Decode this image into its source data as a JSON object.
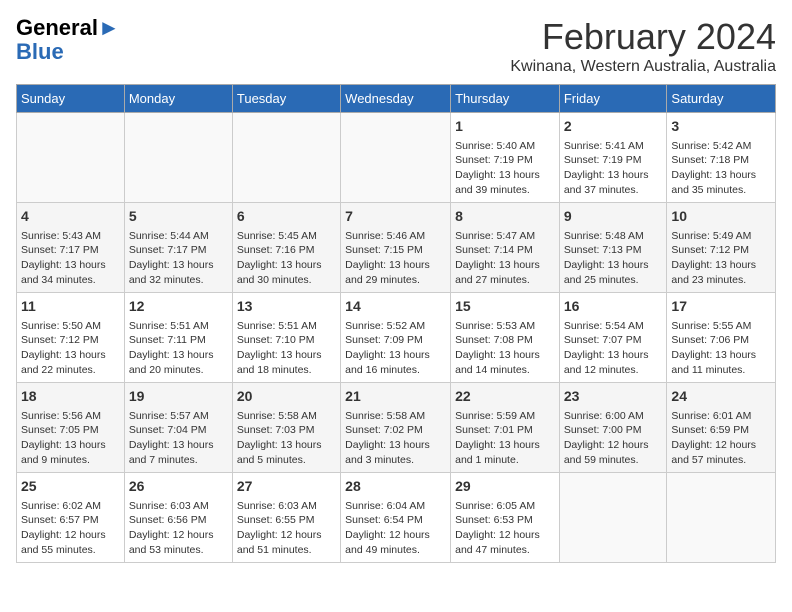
{
  "header": {
    "logo_general": "General",
    "logo_blue": "Blue",
    "title": "February 2024",
    "subtitle": "Kwinana, Western Australia, Australia"
  },
  "days_of_week": [
    "Sunday",
    "Monday",
    "Tuesday",
    "Wednesday",
    "Thursday",
    "Friday",
    "Saturday"
  ],
  "weeks": [
    [
      {
        "day": "",
        "content": ""
      },
      {
        "day": "",
        "content": ""
      },
      {
        "day": "",
        "content": ""
      },
      {
        "day": "",
        "content": ""
      },
      {
        "day": "1",
        "content": "Sunrise: 5:40 AM\nSunset: 7:19 PM\nDaylight: 13 hours\nand 39 minutes."
      },
      {
        "day": "2",
        "content": "Sunrise: 5:41 AM\nSunset: 7:19 PM\nDaylight: 13 hours\nand 37 minutes."
      },
      {
        "day": "3",
        "content": "Sunrise: 5:42 AM\nSunset: 7:18 PM\nDaylight: 13 hours\nand 35 minutes."
      }
    ],
    [
      {
        "day": "4",
        "content": "Sunrise: 5:43 AM\nSunset: 7:17 PM\nDaylight: 13 hours\nand 34 minutes."
      },
      {
        "day": "5",
        "content": "Sunrise: 5:44 AM\nSunset: 7:17 PM\nDaylight: 13 hours\nand 32 minutes."
      },
      {
        "day": "6",
        "content": "Sunrise: 5:45 AM\nSunset: 7:16 PM\nDaylight: 13 hours\nand 30 minutes."
      },
      {
        "day": "7",
        "content": "Sunrise: 5:46 AM\nSunset: 7:15 PM\nDaylight: 13 hours\nand 29 minutes."
      },
      {
        "day": "8",
        "content": "Sunrise: 5:47 AM\nSunset: 7:14 PM\nDaylight: 13 hours\nand 27 minutes."
      },
      {
        "day": "9",
        "content": "Sunrise: 5:48 AM\nSunset: 7:13 PM\nDaylight: 13 hours\nand 25 minutes."
      },
      {
        "day": "10",
        "content": "Sunrise: 5:49 AM\nSunset: 7:12 PM\nDaylight: 13 hours\nand 23 minutes."
      }
    ],
    [
      {
        "day": "11",
        "content": "Sunrise: 5:50 AM\nSunset: 7:12 PM\nDaylight: 13 hours\nand 22 minutes."
      },
      {
        "day": "12",
        "content": "Sunrise: 5:51 AM\nSunset: 7:11 PM\nDaylight: 13 hours\nand 20 minutes."
      },
      {
        "day": "13",
        "content": "Sunrise: 5:51 AM\nSunset: 7:10 PM\nDaylight: 13 hours\nand 18 minutes."
      },
      {
        "day": "14",
        "content": "Sunrise: 5:52 AM\nSunset: 7:09 PM\nDaylight: 13 hours\nand 16 minutes."
      },
      {
        "day": "15",
        "content": "Sunrise: 5:53 AM\nSunset: 7:08 PM\nDaylight: 13 hours\nand 14 minutes."
      },
      {
        "day": "16",
        "content": "Sunrise: 5:54 AM\nSunset: 7:07 PM\nDaylight: 13 hours\nand 12 minutes."
      },
      {
        "day": "17",
        "content": "Sunrise: 5:55 AM\nSunset: 7:06 PM\nDaylight: 13 hours\nand 11 minutes."
      }
    ],
    [
      {
        "day": "18",
        "content": "Sunrise: 5:56 AM\nSunset: 7:05 PM\nDaylight: 13 hours\nand 9 minutes."
      },
      {
        "day": "19",
        "content": "Sunrise: 5:57 AM\nSunset: 7:04 PM\nDaylight: 13 hours\nand 7 minutes."
      },
      {
        "day": "20",
        "content": "Sunrise: 5:58 AM\nSunset: 7:03 PM\nDaylight: 13 hours\nand 5 minutes."
      },
      {
        "day": "21",
        "content": "Sunrise: 5:58 AM\nSunset: 7:02 PM\nDaylight: 13 hours\nand 3 minutes."
      },
      {
        "day": "22",
        "content": "Sunrise: 5:59 AM\nSunset: 7:01 PM\nDaylight: 13 hours\nand 1 minute."
      },
      {
        "day": "23",
        "content": "Sunrise: 6:00 AM\nSunset: 7:00 PM\nDaylight: 12 hours\nand 59 minutes."
      },
      {
        "day": "24",
        "content": "Sunrise: 6:01 AM\nSunset: 6:59 PM\nDaylight: 12 hours\nand 57 minutes."
      }
    ],
    [
      {
        "day": "25",
        "content": "Sunrise: 6:02 AM\nSunset: 6:57 PM\nDaylight: 12 hours\nand 55 minutes."
      },
      {
        "day": "26",
        "content": "Sunrise: 6:03 AM\nSunset: 6:56 PM\nDaylight: 12 hours\nand 53 minutes."
      },
      {
        "day": "27",
        "content": "Sunrise: 6:03 AM\nSunset: 6:55 PM\nDaylight: 12 hours\nand 51 minutes."
      },
      {
        "day": "28",
        "content": "Sunrise: 6:04 AM\nSunset: 6:54 PM\nDaylight: 12 hours\nand 49 minutes."
      },
      {
        "day": "29",
        "content": "Sunrise: 6:05 AM\nSunset: 6:53 PM\nDaylight: 12 hours\nand 47 minutes."
      },
      {
        "day": "",
        "content": ""
      },
      {
        "day": "",
        "content": ""
      }
    ]
  ]
}
